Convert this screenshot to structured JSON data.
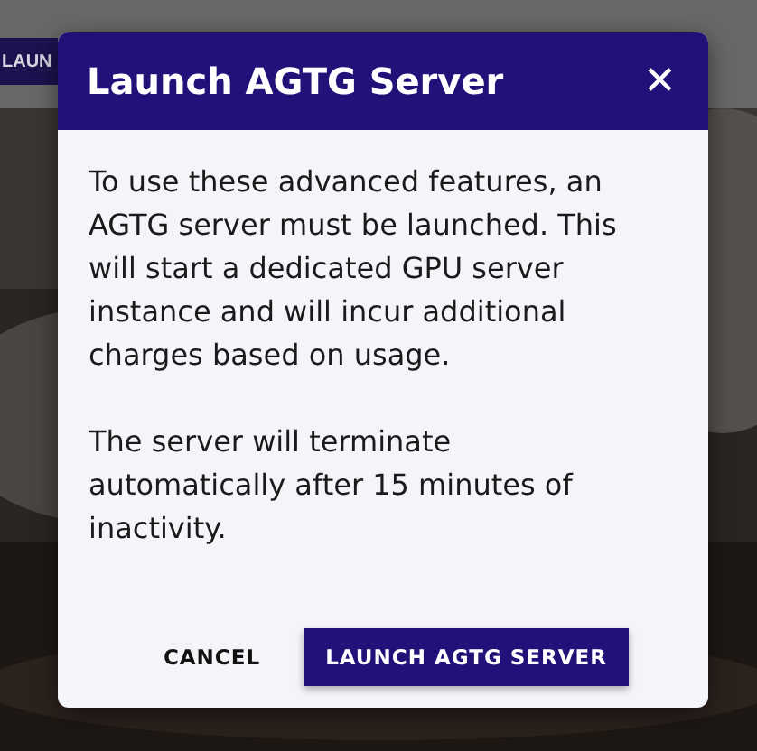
{
  "background": {
    "kind": "picture",
    "button": "LAUN"
  },
  "dialog": {
    "title": "Launch AGTG Server",
    "close": "✕",
    "paragraphs": [
      "To use these advanced features, an AGTG server must be launched. This will start a dedicated GPU server instance and will incur additional charges based on usage.",
      "The server will terminate automatically after 15 minutes of inactivity."
    ],
    "buttons": [
      {
        "label": "CANCEL",
        "kind": "text"
      },
      {
        "label": "LAUNCH AGTG SERVER",
        "kind": "primary"
      }
    ]
  }
}
